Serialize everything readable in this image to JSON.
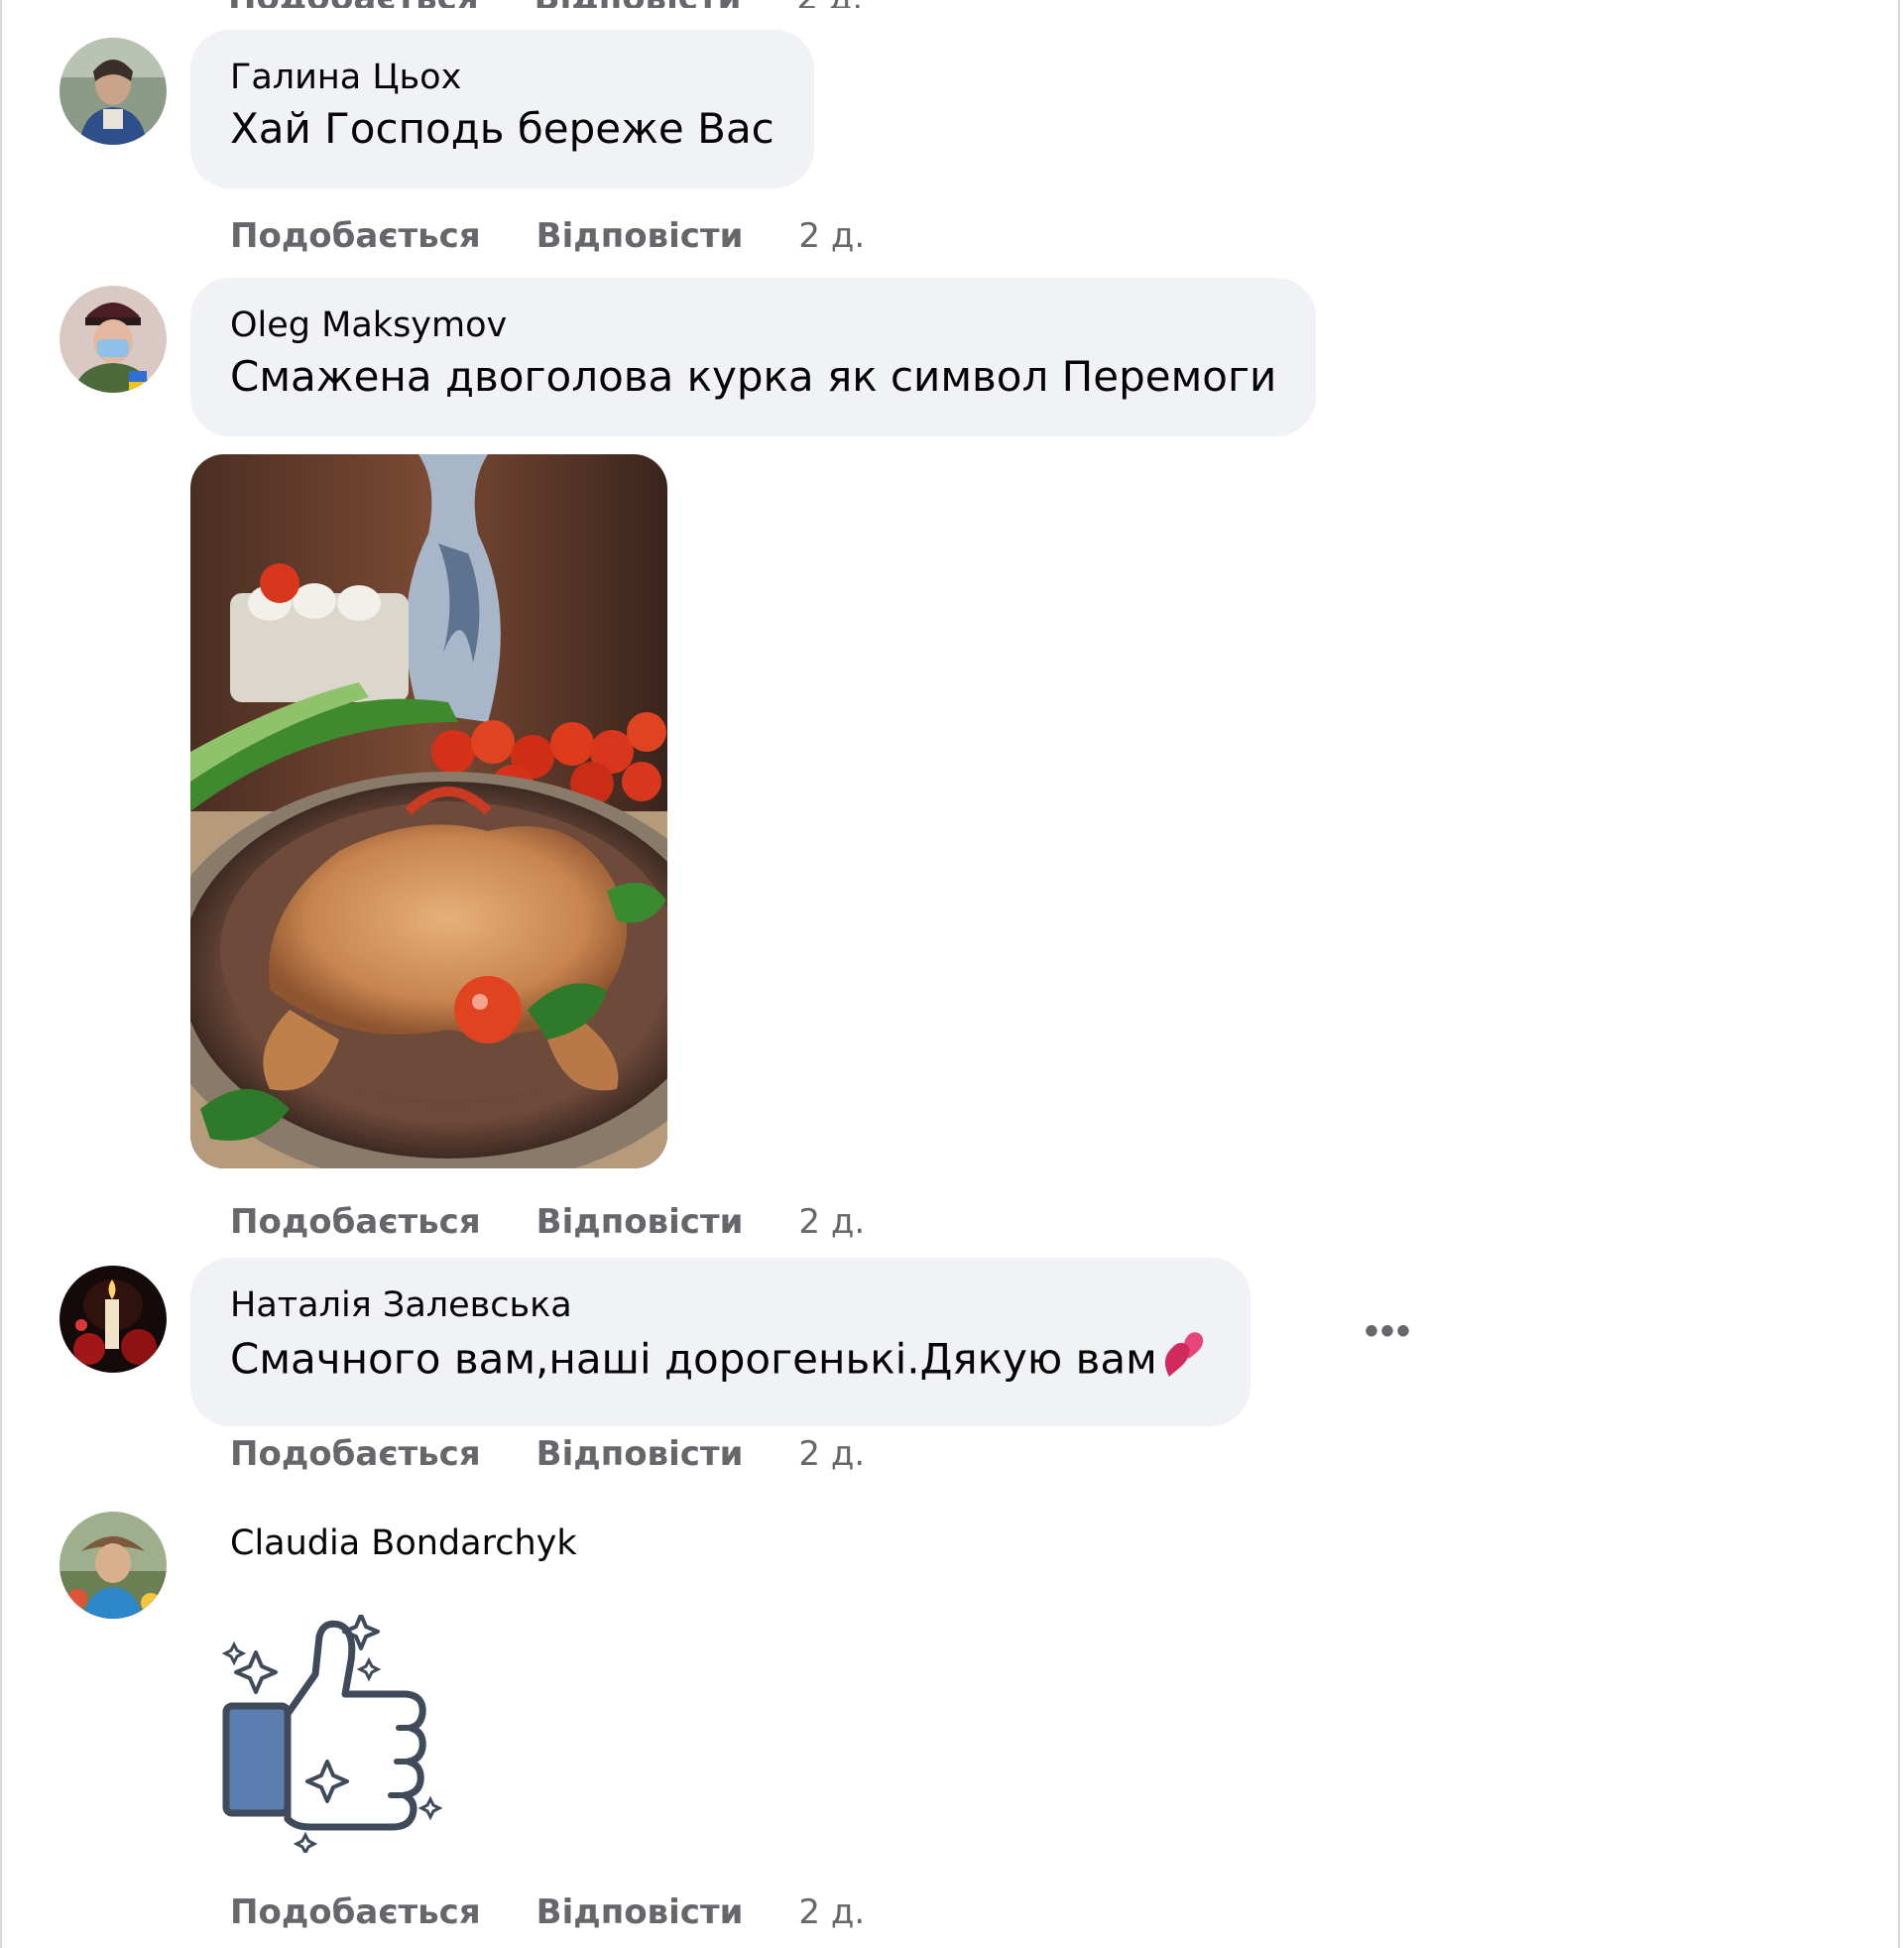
{
  "colors": {
    "bubble_bg": "#f0f2f5",
    "meta_text": "#65676b",
    "body_text": "#050505",
    "sticker_blue": "#5b7db0",
    "sticker_outline": "#3f4a5a"
  },
  "partial_top_actions": {
    "like": "Подобається",
    "reply": "Відповісти",
    "time": "2 д."
  },
  "comments": [
    {
      "author": "Галина Цьох",
      "text": "Хай Господь береже Вас",
      "like": "Подобається",
      "reply": "Відповісти",
      "time": "2 д.",
      "avatar_icon": "profile-photo"
    },
    {
      "author": "Oleg Maksymov",
      "text": "Смажена двоголова курка як символ Перемоги",
      "like": "Подобається",
      "reply": "Відповісти",
      "time": "2 д.",
      "avatar_icon": "profile-photo",
      "attachment": "photo-roast-chicken-with-tomatoes"
    },
    {
      "author": "Наталія Залевська",
      "text": "Смачного вам,наші дорогенькі.Дякую вам",
      "emoji": "two-hearts",
      "like": "Подобається",
      "reply": "Відповісти",
      "time": "2 д.",
      "avatar_icon": "profile-photo",
      "more_options": "•••"
    },
    {
      "author": "Claudia Bondarchyk",
      "sticker": "thumbs-up-sparkle-sticker",
      "like": "Подобається",
      "reply": "Відповісти",
      "time": "2 д.",
      "avatar_icon": "profile-photo"
    }
  ]
}
